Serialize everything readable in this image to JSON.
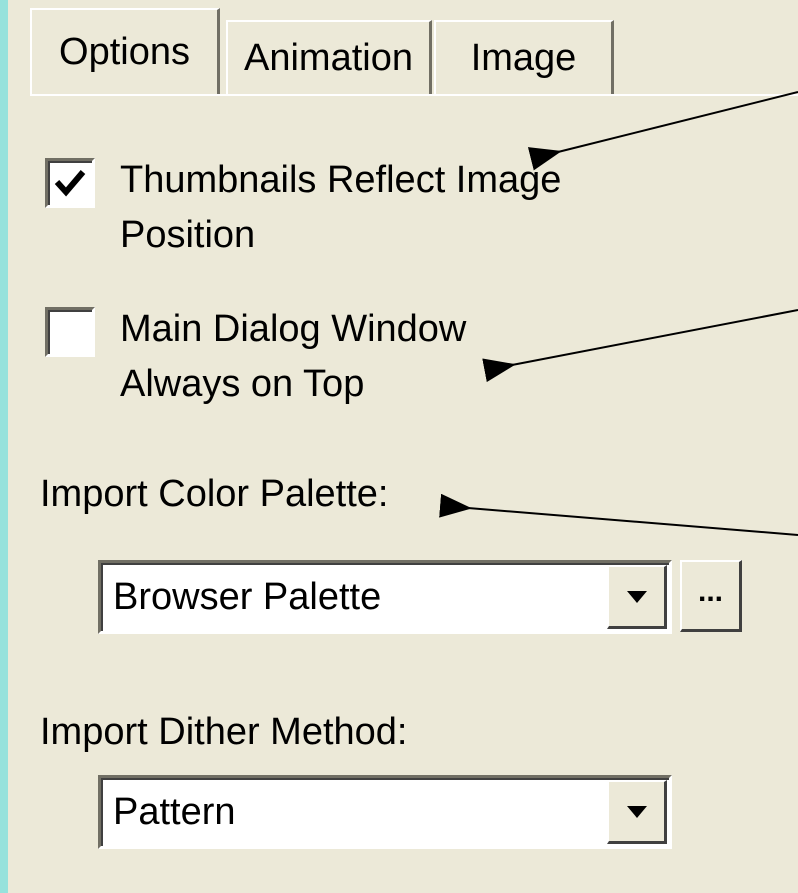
{
  "tabs": {
    "options": "Options",
    "animation": "Animation",
    "image": "Image"
  },
  "options": {
    "thumbnails_reflect": {
      "label": "Thumbnails Reflect Image Position",
      "checked": true
    },
    "always_on_top": {
      "label": "Main Dialog Window Always on Top",
      "checked": false
    },
    "import_color_palette": {
      "label": "Import Color Palette:",
      "value": "Browser Palette",
      "browse_label": "..."
    },
    "import_dither_method": {
      "label": "Import Dither Method:",
      "value": "Pattern"
    }
  },
  "colors": {
    "background_teal": "#97e2dc",
    "panel": "#ece9d8"
  }
}
